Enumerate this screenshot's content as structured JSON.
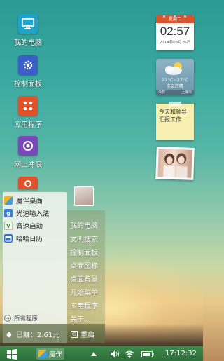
{
  "desktop_icons": [
    {
      "label": "我的电脑",
      "icon": "computer-icon"
    },
    {
      "label": "控制面板",
      "icon": "gear-icon"
    },
    {
      "label": "应用程序",
      "icon": "apps-icon"
    },
    {
      "label": "网上冲浪",
      "icon": "browser-icon"
    }
  ],
  "clock": {
    "weekday": "星期二",
    "time": "02:57",
    "date": "2014年05月26日"
  },
  "weather": {
    "temp": "22°C~27°C",
    "condition": "多云转晴",
    "day": "今日",
    "city": "上海市"
  },
  "note": {
    "text": "今天和领导汇报工作"
  },
  "start_menu": {
    "items": [
      {
        "label": "魔伴桌面",
        "icon": "mobanlauncher-icon"
      },
      {
        "label": "光速输入法",
        "icon": "keyboard-icon"
      },
      {
        "label": "音速启动",
        "icon": "launch-icon"
      },
      {
        "label": "哈哈日历",
        "icon": "calendar-icon"
      }
    ],
    "all_programs": "所有程序",
    "earned": "已赚：2.61元",
    "restart": "重启",
    "right_items": [
      "我的电脑",
      "文明搜索",
      "控制面板",
      "桌面图标",
      "桌面背景",
      "开始菜单",
      "应用程序",
      "关于.."
    ]
  },
  "taskbar": {
    "app_label": "魔伴",
    "time": "17:12:32"
  },
  "colors": {
    "taskbar": "#2c6d3a",
    "accent_red": "#d9532b",
    "note": "#f6efb0"
  }
}
